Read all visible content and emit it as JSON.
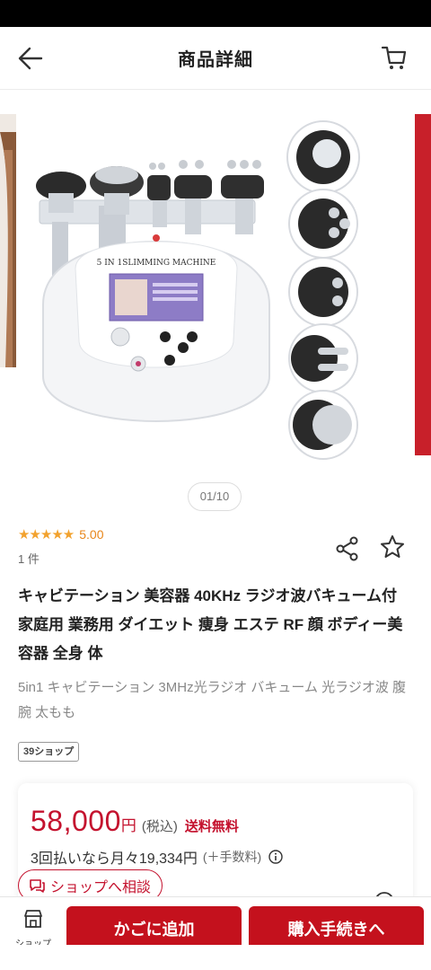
{
  "header": {
    "title": "商品詳細",
    "back_icon": "arrow-left-icon",
    "cart_icon": "cart-icon"
  },
  "gallery": {
    "machine_label": "5 IN 1SLIMMING MACHINE",
    "pager": "01/10"
  },
  "rating": {
    "stars": "★★★★★",
    "value": "5.00",
    "count": "1 件"
  },
  "product": {
    "title": "キャビテーション 美容器 40KHz ラジオ波バキューム付 家庭用 業務用 ダイエット 痩身 エステ RF 顔 ボディー美容器 全身 体",
    "subtitle": "5in1 キャビテーション 3MHz光ラジオ バキューム 光ラジオ波 腹 腕 太もも",
    "shop_tag": "39ショップ"
  },
  "price": {
    "amount": "58,000",
    "yen": "円",
    "tax": "(税込)",
    "shipping": "送料無料",
    "installment": "3回払いなら月々19,334円",
    "installment_fee": "(＋手数料)",
    "consult_label": "ショップへ相談"
  },
  "bottom": {
    "shop_label": "ショップ",
    "add_to_cart": "かごに追加",
    "checkout": "購入手続きへ"
  },
  "colors": {
    "accent": "#c4111d",
    "star": "#f2a22e",
    "rating_text": "#e8861a"
  }
}
